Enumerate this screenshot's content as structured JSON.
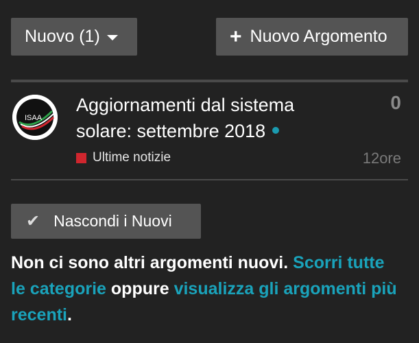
{
  "toolbar": {
    "filter_label": "Nuovo (1)",
    "new_topic_label": "Nuovo Argomento",
    "icons": {
      "filter_caret": "caret-down-icon",
      "new_topic": "plus-icon"
    }
  },
  "topic": {
    "title": "Aggiornamenti dal sistema solare: settembre 2018",
    "avatar_text": "ISAA",
    "replies": "0",
    "category": "Ultime notizie",
    "category_color": "#d0262e",
    "age": "12ore",
    "unread_dot_color": "#1b9bb0"
  },
  "dismiss": {
    "label": "Nascondi i Nuovi",
    "icon": "check-icon"
  },
  "footer": {
    "text1": "Non ci sono altri argomenti nuovi.",
    "link1": "Scorri tutte le categorie",
    "text2": "oppure",
    "link2": "visualizza gli argomenti più recenti",
    "text3": "."
  },
  "colors": {
    "background": "#222222",
    "button": "#545454",
    "link": "#1aa3bb"
  }
}
